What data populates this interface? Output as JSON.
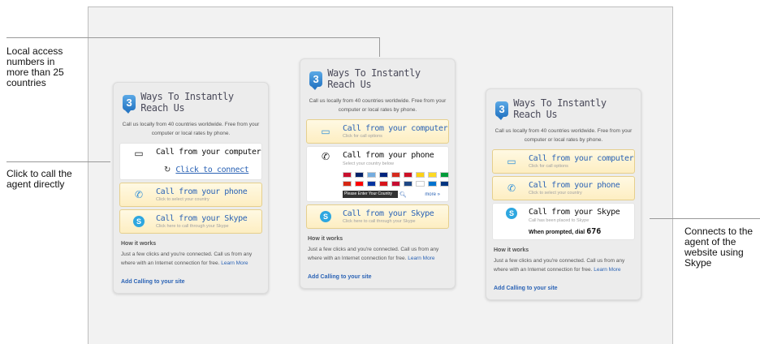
{
  "annotations": {
    "local_access": "Local access numbers in more than 25 countries",
    "click_to_call": "Click to call the agent directly",
    "connects_skype": "Connects to the agent of the website using Skype"
  },
  "widget": {
    "badge": "3",
    "title": "Ways To Instantly Reach Us",
    "subtitle": "Call us locally from 40 countries worldwide. Free from your computer or local rates by phone.",
    "computer_title": "Call from your computer",
    "computer_sub": "Click for call options",
    "connect_link": "Click to connect",
    "phone_title": "Call from your phone",
    "phone_sub": "Click to select your country",
    "phone_sub_expanded": "Select your country below",
    "country_placeholder": "Please Enter Your Country",
    "more": "more »",
    "skype_title": "Call from your Skype",
    "skype_sub": "Click here to call through your Skype",
    "skype_placed": "Call has been placed to Skype",
    "dial_prefix": "When prompted, dial",
    "dial_number": "676",
    "how_title": "How it works",
    "how_text": "Just a few clicks and you're connected. Call us from any where with an Internet connection for free.",
    "learn_more": "Learn More",
    "add_calling": "Add Calling to your site"
  },
  "icons": {
    "computer": "computer-icon",
    "phone": "phone-icon",
    "skype": "skype-icon",
    "refresh": "refresh-icon",
    "search": "search-icon"
  },
  "flag_colors": [
    "#c8102e",
    "#012169",
    "#74acdf",
    "#00247d",
    "#d52b1e",
    "#ce1126",
    "#fcd116",
    "#fdda24",
    "#009c3b",
    "#d62612",
    "#ff0000",
    "#0033a0",
    "#d7141a",
    "#c60c30",
    "#1e4785",
    "#ffffff",
    "#0072ce",
    "#003580"
  ]
}
